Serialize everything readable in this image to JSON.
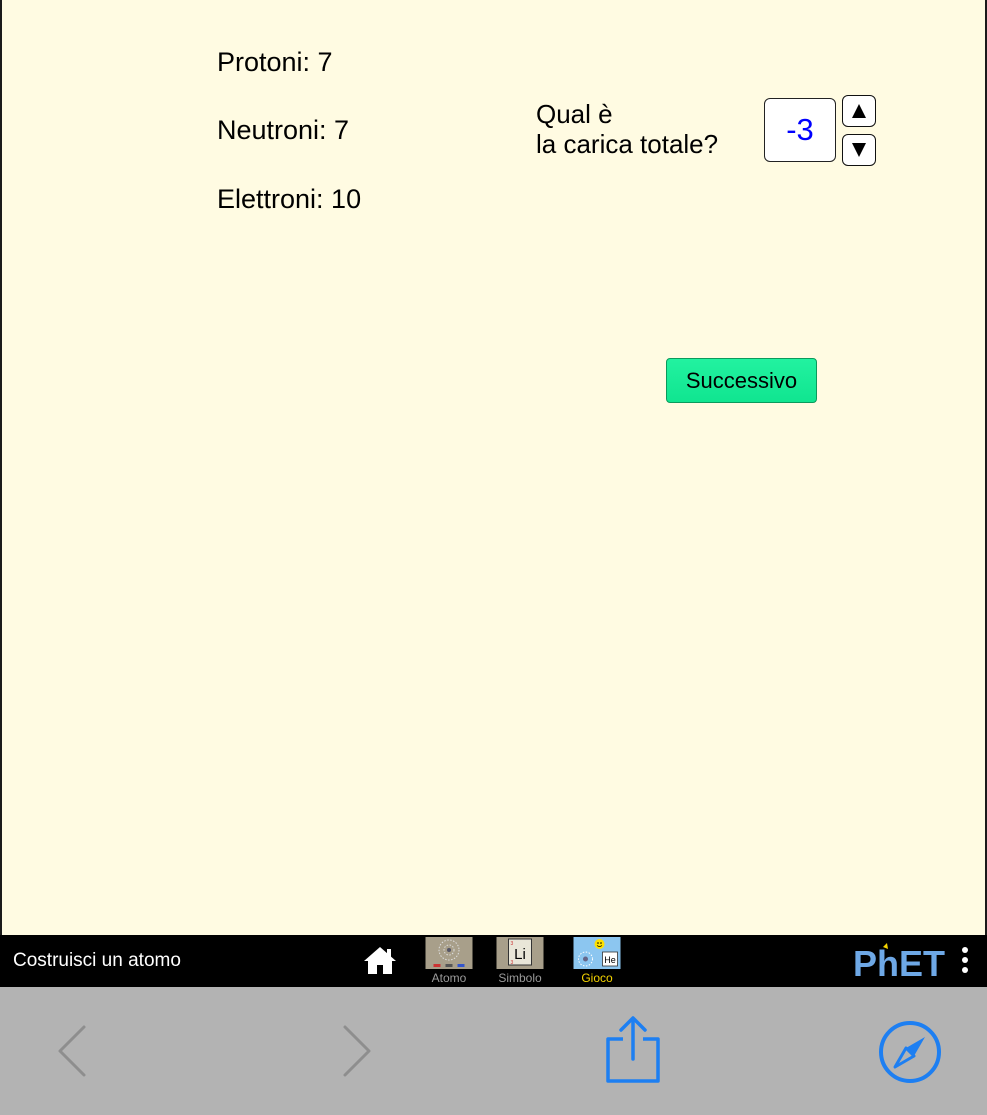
{
  "particles": {
    "protons": "Protoni: 7",
    "neutrons": "Neutroni: 7",
    "electrons": "Elettroni: 10"
  },
  "question": {
    "line1": "Qual è",
    "line2": "la carica totale?"
  },
  "charge_value": "-3",
  "next_button": "Successivo",
  "navbar": {
    "app_title": "Costruisci un atomo",
    "screens": [
      {
        "label": "Atomo",
        "thumb": "Atomo-thumbnail"
      },
      {
        "label": "Simbolo",
        "thumb": "Simbolo-thumbnail",
        "symbol": "Li"
      },
      {
        "label": "Gioco",
        "thumb": "Gioco-thumbnail",
        "symbol": "He",
        "active": true
      }
    ],
    "logo": "PhET"
  },
  "colors": {
    "sim_background": "#fffbe2",
    "charge_text": "#0000ff",
    "next_button": "#10e590",
    "active_screen_label": "#f5d400",
    "ios_blue": "#1d7ff2",
    "browser_bar": "#b3b3b3"
  },
  "browser": {
    "icons": [
      "back-chevron-icon",
      "forward-chevron-icon",
      "share-icon",
      "compass-icon"
    ]
  }
}
